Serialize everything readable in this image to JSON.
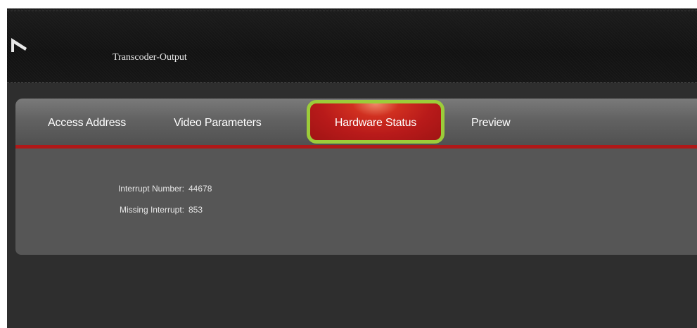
{
  "header": {
    "title": "Transcoder-Output",
    "logo_icon": "logo-icon"
  },
  "tabs": [
    {
      "label": "Access Address",
      "active": false
    },
    {
      "label": "Video Parameters",
      "active": false
    },
    {
      "label": "Hardware Status",
      "active": true
    },
    {
      "label": "Preview",
      "active": false
    }
  ],
  "hardware_status": {
    "interrupt_number_label": "Interrupt Number:",
    "interrupt_number_value": "44678",
    "missing_interrupt_label": "Missing Interrupt:",
    "missing_interrupt_value": "853"
  },
  "colors": {
    "accent_red": "#b01818",
    "highlight_green": "#9ccc3a"
  }
}
